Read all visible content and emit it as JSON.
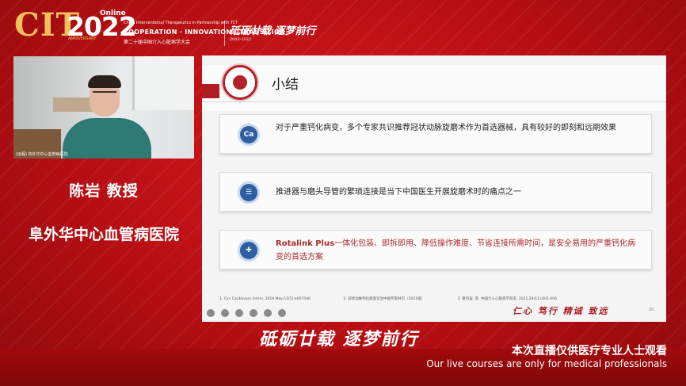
{
  "header": {
    "logo_main": "CIT",
    "logo_year": "2022",
    "logo_online": "Online",
    "logo_anniversary": "ANNIVERSARY",
    "subtitle_en_top": "China Interventional Therapeutics in Partnership with TCT",
    "subtitle_en": "COOPERATION · INNOVATION · TRANSITION",
    "subtitle_cn": "第二十届中国介入心脏病学大会",
    "slogan": "砥砺廿载 逐梦前行",
    "slogan_years": "2003-2022"
  },
  "speaker": {
    "video_caption": "(远程) 阜外华中心血管病医院",
    "name": "陈岩 教授",
    "organization": "阜外华中心血管病医院"
  },
  "slide": {
    "title": "小结",
    "points": [
      {
        "icon": "Ca",
        "text": "对于严重钙化病变，多个专家共识推荐冠状动脉旋磨术作为首选器械，具有较好的即刻和远期效果"
      },
      {
        "icon": "",
        "text": "推进器与磨头导管的繁琐连接是当下中国医生开展旋磨术时的痛点之一"
      },
      {
        "icon": "",
        "brand": "Rotalink Plus",
        "text": "一体化包装、即拆即用、降低操作难度、节省连接所需时间，是安全易用的严重钙化病变的首选方案"
      }
    ],
    "refs": [
      "1. Circ Cardiovasc Interv. 2019 May;12(5):e007446",
      "2. 冠状动脉钙化病变诊治中国专家共识（2021版）",
      "3. 葛均波, 等. 中国介入心脏病学杂志. 2021,29(11):601-606."
    ],
    "motto": "仁心 笃行 精诚 致远",
    "page_number": "20"
  },
  "footer": {
    "slogan": "砥砺廿载 逐梦前行",
    "notice_cn": "本次直播仅供医疗专业人士观看",
    "notice_en": "Our live courses are only for medical professionals"
  },
  "colors": {
    "background_red": "#b80d12",
    "gold": "#f1c15b",
    "slide_accent": "#b01e24",
    "icon_blue": "#2e5fa3"
  }
}
